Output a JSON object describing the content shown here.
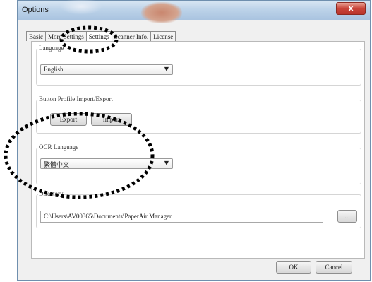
{
  "window": {
    "title": "Options",
    "close_glyph": "x"
  },
  "tabs": [
    {
      "label": "Basic",
      "active": false
    },
    {
      "label": "More Settings",
      "active": false
    },
    {
      "label": "Settings",
      "active": true
    },
    {
      "label": "Scanner Info.",
      "active": false
    },
    {
      "label": "License",
      "active": false
    }
  ],
  "language": {
    "group_label": "Language",
    "selected": "English"
  },
  "button_profile": {
    "group_label": "Button Profile Import/Export",
    "export_label": "Export",
    "import_label": "Import"
  },
  "ocr_language": {
    "group_label": "OCR Language",
    "selected": "繁體中文"
  },
  "directory": {
    "group_label": "Directory",
    "path": "C:\\Users\\AV00365\\Documents\\PaperAir Manager",
    "browse_label": "..."
  },
  "footer": {
    "ok_label": "OK",
    "cancel_label": "Cancel"
  },
  "icons": {
    "dropdown": "chevron-down-icon"
  },
  "colors": {
    "annotation": "#000000",
    "close_button": "#c9453a"
  }
}
